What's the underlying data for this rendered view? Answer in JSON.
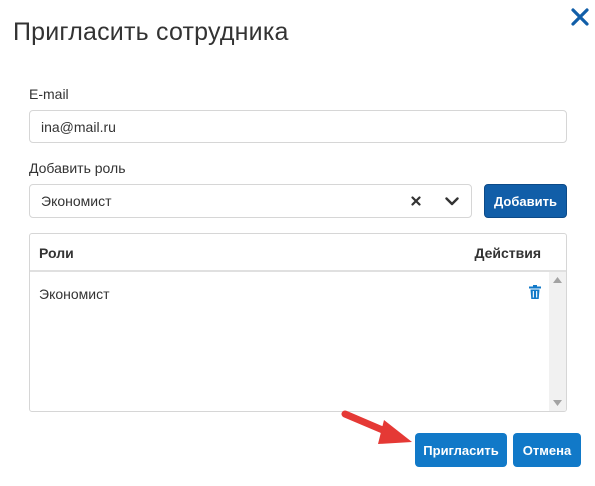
{
  "dialog": {
    "title": "Пригласить сотрудника",
    "close_icon": "close-icon"
  },
  "email": {
    "label": "E-mail",
    "value": "ina@mail.ru"
  },
  "role": {
    "label": "Добавить роль",
    "selected": "Экономист",
    "add_label": "Добавить"
  },
  "roles_table": {
    "headers": {
      "roles": "Роли",
      "actions": "Действия"
    },
    "rows": [
      {
        "name": "Экономист",
        "action_icon": "trash-icon"
      }
    ]
  },
  "footer": {
    "invite_label": "Пригласить",
    "cancel_label": "Отмена"
  },
  "colors": {
    "accent": "#1179c8",
    "accent_dark": "#115ea8",
    "annotation_arrow": "#e53935"
  }
}
